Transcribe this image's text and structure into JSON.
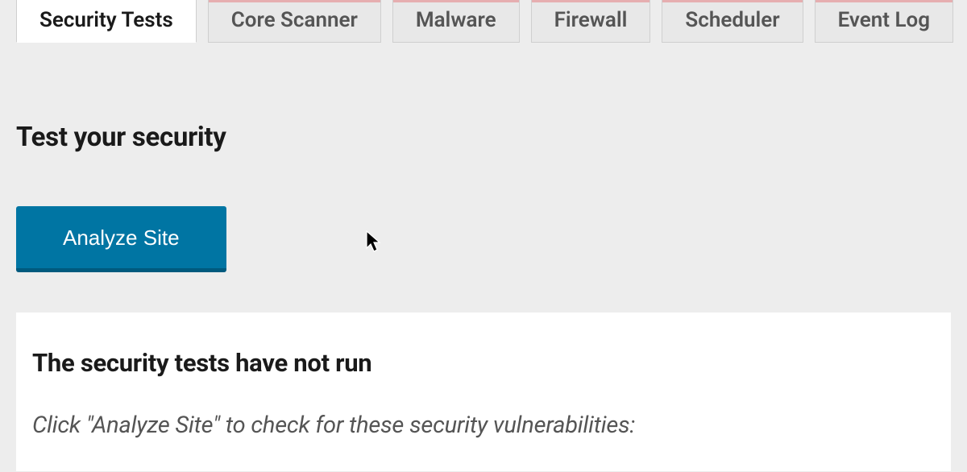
{
  "tabs": [
    {
      "label": "Security Tests",
      "active": true
    },
    {
      "label": "Core Scanner",
      "active": false
    },
    {
      "label": "Malware",
      "active": false
    },
    {
      "label": "Firewall",
      "active": false
    },
    {
      "label": "Scheduler",
      "active": false
    },
    {
      "label": "Event Log",
      "active": false
    }
  ],
  "main": {
    "section_title": "Test your security",
    "analyze_button_label": "Analyze Site",
    "panel_title": "The security tests have not run",
    "panel_subtitle": "Click \"Analyze Site\" to check for these security vulnerabilities:"
  }
}
